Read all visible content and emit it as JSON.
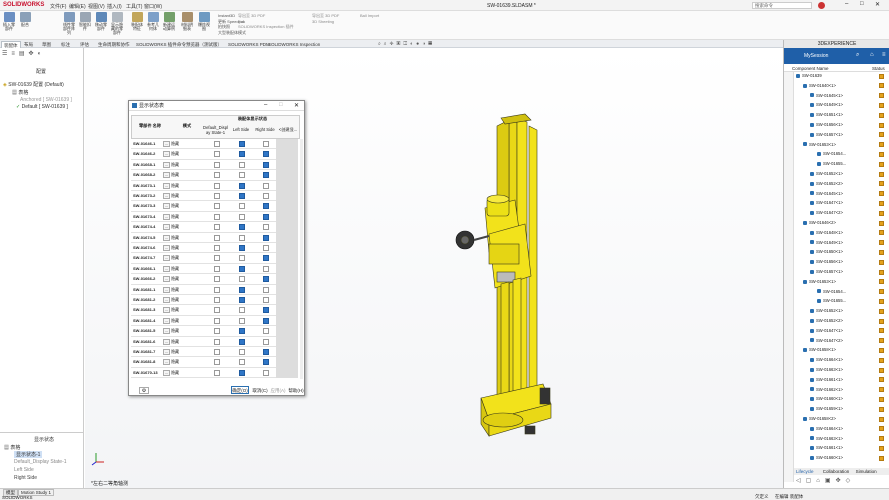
{
  "app": {
    "name": "SOLIDWORKS",
    "doc_title": "SW-01639.SLDASM *",
    "search_placeholder": "搜索命令"
  },
  "menu": [
    "文件(F)",
    "编辑(E)",
    "视图(V)",
    "插入(I)",
    "工具(T)",
    "窗口(W)"
  ],
  "ribbon": {
    "buttons": [
      "插入零部件",
      "配合",
      "线性零部件阵列",
      "智能扣件",
      "移动零部件",
      "显示隐藏的零部件",
      "装配体特征",
      "参考几何体",
      "新建运动算例",
      "材料明细表",
      "爆炸视图"
    ],
    "text_items": [
      "Instant3D",
      "更新 Speedpak",
      "拍快照",
      "大型装配体模式",
      "导出至 3D PDF",
      "Ext",
      "导出至 3D PDF",
      "SOLIDWORKS Inspection 插件",
      "导出至 3D PDF",
      "3D Sheeting",
      "Ball Import"
    ]
  },
  "tabs": [
    "装配体",
    "布局",
    "草图",
    "标注",
    "评估",
    "生命周期和协作",
    "SOLIDWORKS 插件",
    "命令预览器（测试版）",
    "SOLIDWORKS PDM",
    "SOLIDWORKS Inspection"
  ],
  "left_panel": {
    "header": "配置",
    "tree": [
      "SW-01639 配置  (Default)",
      "表格",
      "Anchored [ SW-01639 ]",
      "Default [ SW-01639 ]"
    ],
    "display_header": "显示状态",
    "display_items": [
      "表格",
      "显示状态-1",
      "Default_Display State-1",
      "Left Side",
      "Right Side"
    ]
  },
  "viewport": {
    "view_label": "*左右二等角轴测"
  },
  "right_panel": {
    "header": "3DEXPERIENCE",
    "session": "MySession",
    "col_component": "Component Name",
    "col_status": "Status",
    "tree": [
      {
        "label": "SW-01639",
        "lvl": 0
      },
      {
        "label": "SW-01640<1>",
        "lvl": 1
      },
      {
        "label": "SW-01645<1>",
        "lvl": 2
      },
      {
        "label": "SW-01649<1>",
        "lvl": 2
      },
      {
        "label": "SW-01651<1>",
        "lvl": 2
      },
      {
        "label": "SW-01656<1>",
        "lvl": 2
      },
      {
        "label": "SW-01657<1>",
        "lvl": 2
      },
      {
        "label": "SW-01653<1>",
        "lvl": 1
      },
      {
        "label": "SW-01654...",
        "lvl": 3
      },
      {
        "label": "SW-01655...",
        "lvl": 3
      },
      {
        "label": "SW-01652<1>",
        "lvl": 2
      },
      {
        "label": "SW-01652<2>",
        "lvl": 2
      },
      {
        "label": "SW-01645<1>",
        "lvl": 2
      },
      {
        "label": "SW-01647<1>",
        "lvl": 2
      },
      {
        "label": "SW-01647<2>",
        "lvl": 2
      },
      {
        "label": "SW-01646<2>",
        "lvl": 1
      },
      {
        "label": "SW-01648<1>",
        "lvl": 2
      },
      {
        "label": "SW-01649<1>",
        "lvl": 2
      },
      {
        "label": "SW-01650<1>",
        "lvl": 2
      },
      {
        "label": "SW-01656<1>",
        "lvl": 2
      },
      {
        "label": "SW-01657<1>",
        "lvl": 2
      },
      {
        "label": "SW-01653<1>",
        "lvl": 1
      },
      {
        "label": "SW-01654...",
        "lvl": 3
      },
      {
        "label": "SW-01655...",
        "lvl": 3
      },
      {
        "label": "SW-01652<1>",
        "lvl": 2
      },
      {
        "label": "SW-01652<2>",
        "lvl": 2
      },
      {
        "label": "SW-01647<1>",
        "lvl": 2
      },
      {
        "label": "SW-01647<2>",
        "lvl": 2
      },
      {
        "label": "SW-01658<1>",
        "lvl": 1
      },
      {
        "label": "SW-01664<1>",
        "lvl": 2
      },
      {
        "label": "SW-01663<1>",
        "lvl": 2
      },
      {
        "label": "SW-01661<1>",
        "lvl": 2
      },
      {
        "label": "SW-01662<1>",
        "lvl": 2
      },
      {
        "label": "SW-01660<1>",
        "lvl": 2
      },
      {
        "label": "SW-01659<1>",
        "lvl": 2
      },
      {
        "label": "SW-01658<2>",
        "lvl": 1
      },
      {
        "label": "SW-01664<1>",
        "lvl": 2
      },
      {
        "label": "SW-01663<1>",
        "lvl": 2
      },
      {
        "label": "SW-01661<1>",
        "lvl": 2
      },
      {
        "label": "SW-01660<1>",
        "lvl": 2
      }
    ],
    "bottom_tabs": [
      "Lifecycle",
      "Collaboration",
      "Simulation"
    ]
  },
  "dialog": {
    "title": "显示状态表",
    "col_component": "零部件 名称",
    "col_mode": "模式",
    "col_group": "装配体显示状态",
    "cols": [
      "Default_Displ ay State-1",
      "Left Side",
      "Right Side",
      "<创建显..."
    ],
    "mode_value": "隐藏",
    "rows": [
      {
        "name": "SW-01646-1",
        "c": [
          0,
          1,
          0
        ]
      },
      {
        "name": "SW-01646-2",
        "c": [
          0,
          1,
          1
        ]
      },
      {
        "name": "SW-01668-1",
        "c": [
          0,
          0,
          1
        ]
      },
      {
        "name": "SW-01668-2",
        "c": [
          0,
          0,
          1
        ]
      },
      {
        "name": "SW-01673-1",
        "c": [
          0,
          1,
          0
        ]
      },
      {
        "name": "SW-01673-2",
        "c": [
          0,
          1,
          0
        ]
      },
      {
        "name": "SW-01673-3",
        "c": [
          0,
          0,
          1
        ]
      },
      {
        "name": "SW-01673-4",
        "c": [
          0,
          0,
          1
        ]
      },
      {
        "name": "SW-01674-4",
        "c": [
          0,
          1,
          0
        ]
      },
      {
        "name": "SW-01674-5",
        "c": [
          0,
          0,
          1
        ]
      },
      {
        "name": "SW-01674-6",
        "c": [
          0,
          1,
          0
        ]
      },
      {
        "name": "SW-01674-7",
        "c": [
          0,
          0,
          1
        ]
      },
      {
        "name": "SW-01666-1",
        "c": [
          0,
          1,
          0
        ]
      },
      {
        "name": "SW-01666-2",
        "c": [
          0,
          0,
          1
        ]
      },
      {
        "name": "SW-01681-1",
        "c": [
          0,
          1,
          0
        ]
      },
      {
        "name": "SW-01681-2",
        "c": [
          0,
          1,
          0
        ]
      },
      {
        "name": "SW-01681-3",
        "c": [
          0,
          0,
          1
        ]
      },
      {
        "name": "SW-01681-4",
        "c": [
          0,
          0,
          1
        ]
      },
      {
        "name": "SW-01681-5",
        "c": [
          0,
          1,
          0
        ]
      },
      {
        "name": "SW-01681-6",
        "c": [
          0,
          1,
          0
        ]
      },
      {
        "name": "SW-01681-7",
        "c": [
          0,
          0,
          1
        ]
      },
      {
        "name": "SW-01681-8",
        "c": [
          0,
          0,
          1
        ]
      },
      {
        "name": "SW-01670-13",
        "c": [
          0,
          1,
          0
        ]
      }
    ],
    "ok": "确定(O)",
    "cancel": "取消(C)",
    "apply": "应用(A)",
    "help": "帮助(H)"
  },
  "status_bar": {
    "left": "SOLIDWORKS",
    "right1": "欠定义",
    "right2": "在编辑 装配体"
  },
  "bottom_tabs": [
    "模型",
    "Motion Study 1"
  ],
  "colors": {
    "model_yellow": "#f2e21b",
    "accent_blue": "#1f5fa8",
    "status_orange": "#e4a21c"
  }
}
